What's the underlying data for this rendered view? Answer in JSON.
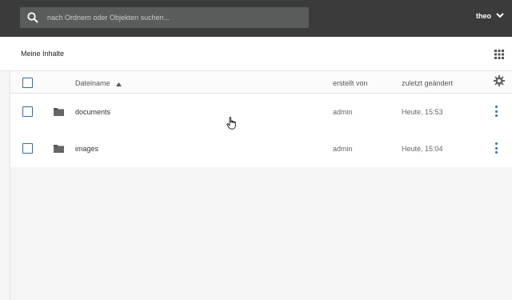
{
  "header": {
    "search_placeholder": "nach Ordnern oder Objekten suchen...",
    "user_name": "theo"
  },
  "subheader": {
    "title": "Meine Inhalte"
  },
  "table": {
    "columns": {
      "name": "Dateiname",
      "author": "erstellt von",
      "modified": "zuletzt geändert"
    },
    "sort": "Dateiname ascending",
    "rows": [
      {
        "name": "documents",
        "author": "admin",
        "modified": "Heute, 15:53",
        "type": "folder"
      },
      {
        "name": "images",
        "author": "admin",
        "modified": "Heute, 15:04",
        "type": "folder"
      }
    ]
  },
  "icons": {
    "search": "search-icon",
    "user_menu": "chevron-down-icon",
    "view_toggle": "grid-view-icon",
    "settings": "gear-icon",
    "row_menu": "kebab-menu-icon",
    "folder": "folder-icon"
  },
  "colors": {
    "topbar": "#3a3b3a",
    "search_bg": "#5a5c5b",
    "accent": "#2f6fa8"
  }
}
